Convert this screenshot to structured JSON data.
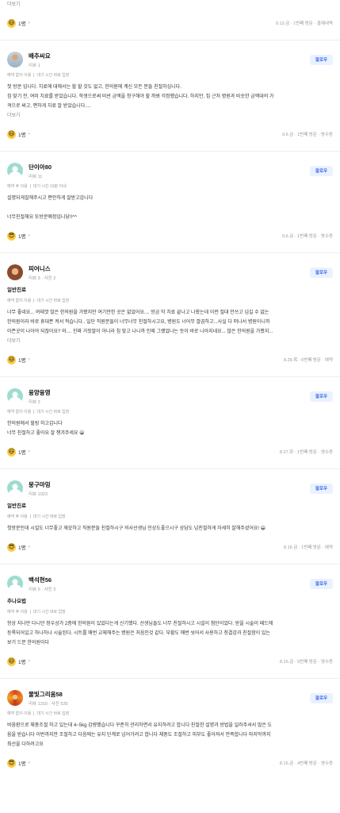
{
  "top": {
    "more_label": "더보기",
    "reaction_count": "1명",
    "meta": "9.13.금 · 1번째 방문 · 결제내역"
  },
  "follow_label": "팔로우",
  "more_label": "더보기",
  "reviews": [
    {
      "name": "배추씨요",
      "stats": "리뷰 1",
      "tag": "",
      "visit_a": "예약 없이 이용",
      "visit_b": "대기 시간 바로 입장",
      "lines": [
        "첫 방문 입니다. 치료에 대해서는 할 할 것도 없고, 한의원에 계신 모든 분들 친절하십니다.",
        "침 맞기 전, 여러 치료를 받았습니다. 학생으로써 비싼 금액을 청구해야 할 까봐 걱정했습니다. 하지만, 집 근처 병원과 비슷한 금액대의 가",
        "격으로 써고, 편하게 치료 잘 받았습니다...."
      ],
      "has_more": true,
      "reaction": "1명",
      "emoji": "laugh",
      "meta": "9.6.금 · 1번째 방문 · 영수증"
    },
    {
      "name": "단이아80",
      "stats": "리뷰 11",
      "tag": "",
      "visit_a": "예약 후 이용",
      "visit_b": "대기 시간 10분 이내",
      "lines": [
        "설명되게잘해주시고 편안하게 잘받고갑니다",
        "",
        "너무친절해요 또방문예정입니당!!^^"
      ],
      "has_more": false,
      "reaction": "1명",
      "emoji": "cool",
      "meta": "9.6.금 · 1번째 방문 · 영수증"
    },
    {
      "name": "피어니스",
      "stats": "리뷰 3 · 사진 2",
      "tag": "일반진료",
      "visit_a": "예약 없이 이용",
      "visit_b": "대기 시간 바로 입장",
      "lines": [
        "너무 좋네요... 여태껏 많은 한의원을 가봤지만 여기만한 곳은 없었어요.... 방금 막 치료 끝나고 나왔는데 이런 절대 안쓰고 넘길 수 없는",
        "한의원이라 바로 휴대폰 켜서 적습니다.. 일단 직원분들이 너무너무 친절하시고요, 병원도 너어무 깔끔하고...사실 다 떠나서 병원이니까",
        "아픈곳이 나아야 되잖아요? 와.... 진짜 거짓말이 아니라 침 맞고 나니까 인제 그랬었나는 듯이 바로 나아지네요... 많은 한의원을 가봤지..."
      ],
      "has_more": true,
      "reaction": "1명",
      "emoji": "laugh",
      "meta": "8.29.목 · 6번째 방문 · 예약"
    },
    {
      "name": "융양융영",
      "stats": "리뷰 3",
      "tag": "",
      "visit_a": "예약 없이 이용",
      "visit_b": "대기 시간 바로 입장",
      "lines": [
        "한의원에서 힐링 하고갑니다",
        "너무 친절하고 좋아요 잘 챙겨주세요 😀"
      ],
      "has_more": false,
      "reaction": "1명",
      "emoji": "laugh",
      "meta": "8.27.화 · 1번째 방문 · 영수증"
    },
    {
      "name": "뭉구마밍",
      "stats": "리뷰 1023",
      "tag": "일반진료",
      "visit_a": "예약 후 이용",
      "visit_b": "대기 시간 바로 입장",
      "lines": [
        "첫방문인데 시설도 너무좋고 깨끗하고 직원분들 친절하시구 의사선생님 인상도좋으시구 상담도 넘친절하게 자세히 잘해주셨어요! 😀"
      ],
      "has_more": false,
      "reaction": "1명",
      "emoji": "cool",
      "meta": "8.16.금 · 1번째 방문 · 예약"
    },
    {
      "name": "백석현56",
      "stats": "리뷰 5 · 사진 3",
      "tag": "추나요법",
      "visit_a": "예약 후 이용",
      "visit_b": "대기 시간 바로 입장",
      "lines": [
        "항상 지나만 다니던 정우상가 2층에 한의원이 있었다는게 신기했다. 선생님들도 너무 친절하시고 시설이 첨단이었다. 받을 시술이 패드에",
        "등록되어있고 하나하나 시술된다. 시트를 매번 교체해주는 병원은 처음인것 같다. 부황도 매번 씻어서 사용하고 청결감과 친절함이 있는",
        "보기 드문 한의원이다"
      ],
      "has_more": false,
      "reaction": "1명",
      "emoji": "laugh",
      "meta": "8.16.금 · 5번째 방문 · 영수증"
    },
    {
      "name": "물빛그리움58",
      "stats": "리뷰 1310 · 사진 526",
      "tag": "",
      "visit_a": "예약 없이 이용",
      "visit_b": "대기 시간 바로 입장",
      "lines": [
        "비움환으로 체중조절 하고 있는데 4~5kg 감량했습니다 꾸준히 관리하면서 유지하려고 합니다 친절한 설명과 방법을 일러주셔서 많은 도",
        "움을 받습니다 이번까지만 조절하고 다음에는 유지 단계로 넘어가려고 합니다 체중도 조절하고 피부도 좋아져서 만족합니다 마지막까지",
        "최선을 다하려고요"
      ],
      "has_more": false,
      "reaction": "1명",
      "emoji": "cool",
      "meta": "8.16.금 · 4번째 방문 · 영수증"
    }
  ]
}
